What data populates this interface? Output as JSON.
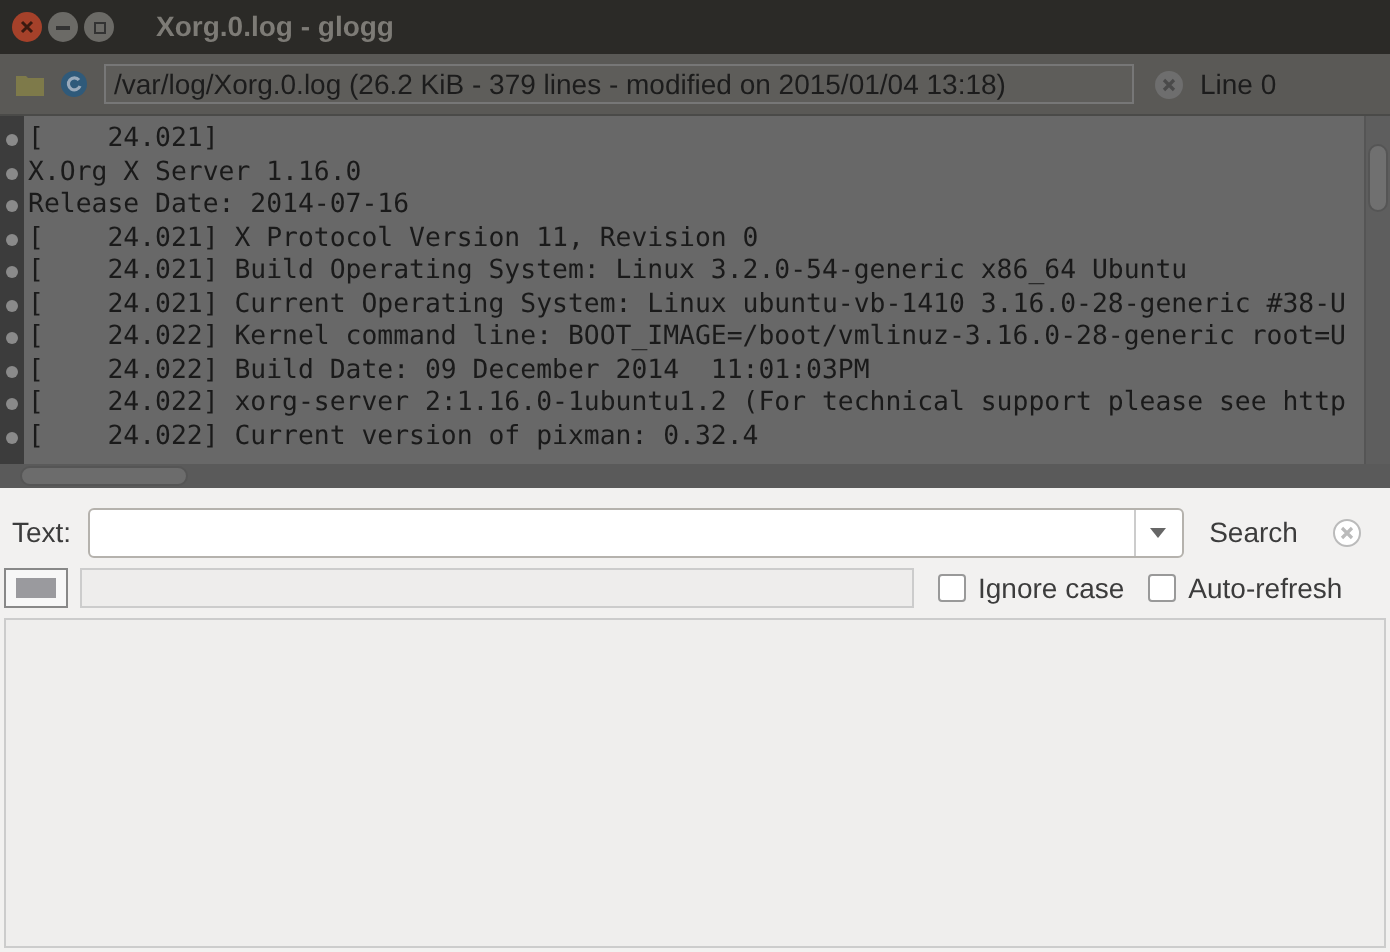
{
  "window": {
    "title": "Xorg.0.log - glogg"
  },
  "toolbar": {
    "file_info": "/var/log/Xorg.0.log (26.2 KiB - 379 lines - modified on 2015/01/04 13:18)",
    "line_indicator": "Line 0"
  },
  "log_lines": [
    "[    24.021]",
    "X.Org X Server 1.16.0",
    "Release Date: 2014-07-16",
    "[    24.021] X Protocol Version 11, Revision 0",
    "[    24.021] Build Operating System: Linux 3.2.0-54-generic x86_64 Ubuntu",
    "[    24.021] Current Operating System: Linux ubuntu-vb-1410 3.16.0-28-generic #38-U",
    "[    24.022] Kernel command line: BOOT_IMAGE=/boot/vmlinuz-3.16.0-28-generic root=U",
    "[    24.022] Build Date: 09 December 2014  11:01:03PM",
    "[    24.022] xorg-server 2:1.16.0-1ubuntu1.2 (For technical support please see http",
    "[    24.022] Current version of pixman: 0.32.4"
  ],
  "search": {
    "label": "Text:",
    "button": "Search"
  },
  "options": [
    {
      "label": "Ignore case",
      "checked": false
    },
    {
      "label": "Auto-refresh",
      "checked": false
    }
  ]
}
